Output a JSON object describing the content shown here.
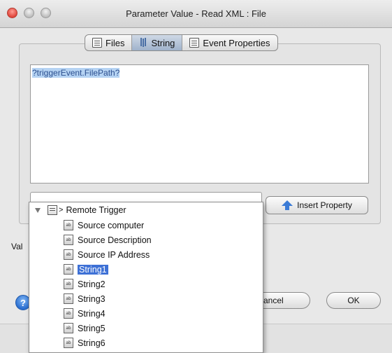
{
  "window": {
    "title": "Parameter Value - Read XML : File"
  },
  "tabs": [
    {
      "label": "Files",
      "icon": "file-list-icon",
      "active": false
    },
    {
      "label": "String",
      "icon": "tool-icon",
      "active": true
    },
    {
      "label": "Event Properties",
      "icon": "properties-icon",
      "active": false
    }
  ],
  "editor": {
    "value": "?triggerEvent.FilePath?"
  },
  "insert_property": {
    "label": "Insert Property"
  },
  "value_label": "Val",
  "buttons": {
    "help": "?",
    "cancel": "ancel",
    "ok": "OK"
  },
  "dropdown": {
    "root": {
      "label": "Remote Trigger",
      "chevron": ">"
    },
    "icon_text": "ab",
    "items": [
      {
        "label": "Source computer",
        "selected": false
      },
      {
        "label": "Source Description",
        "selected": false
      },
      {
        "label": "Source IP Address",
        "selected": false
      },
      {
        "label": "String1",
        "selected": true
      },
      {
        "label": "String2",
        "selected": false
      },
      {
        "label": "String3",
        "selected": false
      },
      {
        "label": "String4",
        "selected": false
      },
      {
        "label": "String5",
        "selected": false
      },
      {
        "label": "String6",
        "selected": false
      }
    ]
  },
  "colors": {
    "selection": "#3e71d6",
    "text_selection": "#b5d3f3",
    "close_button": "#e0463b"
  }
}
